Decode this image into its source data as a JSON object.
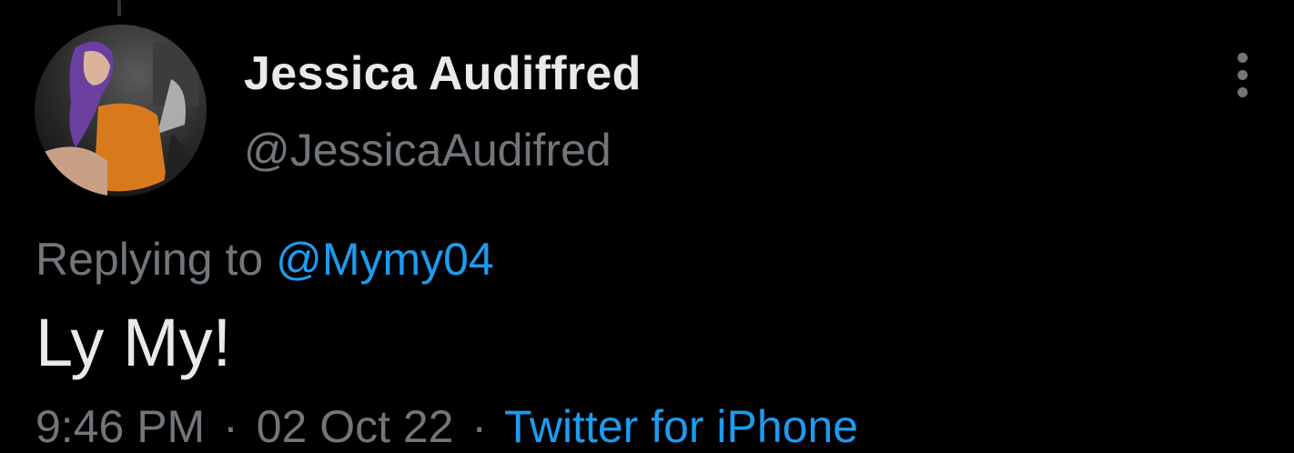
{
  "colors": {
    "background": "#000000",
    "primary_text": "#e7e9ea",
    "secondary_text": "#71767b",
    "link": "#1d9bf0"
  },
  "author": {
    "display_name": "Jessica Audiffred",
    "handle": "@JessicaAudifred",
    "avatar_icon": "profile-photo"
  },
  "reply": {
    "prefix": "Replying to",
    "mention": "@Mymy04"
  },
  "tweet": {
    "text": "Ly My!"
  },
  "meta": {
    "time": "9:46 PM",
    "separator": "·",
    "date": "02 Oct 22",
    "source_separator": "·",
    "source": "Twitter for iPhone"
  },
  "more_menu": {
    "icon": "more-vertical-icon"
  }
}
